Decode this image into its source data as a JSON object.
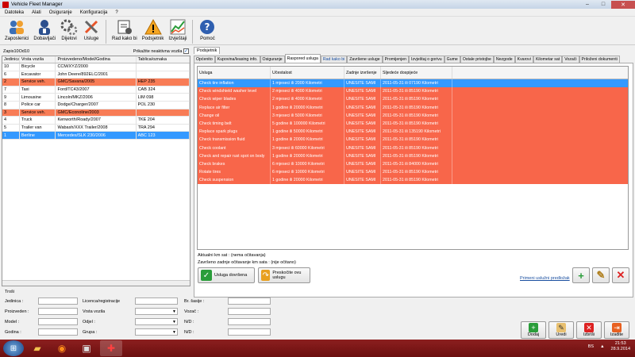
{
  "window": {
    "title": "Vehicle Fleet Manager",
    "min": "–",
    "max": "□",
    "close": "✕"
  },
  "menu": [
    "Datoteka",
    "Alati",
    "Osiguranje",
    "Konfiguracija",
    "?"
  ],
  "toolbar": [
    {
      "label": "Zaposlenici",
      "icon": "people-icon"
    },
    {
      "label": "Dobavljači",
      "icon": "supplier-icon"
    },
    {
      "label": "Dijelovi",
      "icon": "gears-icon"
    },
    {
      "label": "Usluge",
      "icon": "tools-icon"
    },
    {
      "label": "Rad kako bi",
      "icon": "work-order-icon"
    },
    {
      "label": "Podsjetnik",
      "icon": "warning-icon"
    },
    {
      "label": "Izvještaji",
      "icon": "chart-icon"
    },
    {
      "label": "Pomoć",
      "icon": "help-icon"
    }
  ],
  "left": {
    "record_counter": "Zapis10Od10",
    "show_inactive_label": "Prikažite neaktivna vozila",
    "show_inactive_checked": "✓",
    "columns": [
      "Jedinica",
      "Vrsta vozila",
      "Proizvedeno/Model/Godina",
      "Tablica/oznaka"
    ],
    "rows": [
      {
        "jed": "10",
        "vrsta": "Bicycle",
        "model": "CCM/XYZ/2000",
        "tab": "",
        "state": "normal"
      },
      {
        "jed": "6",
        "vrsta": "Excavator",
        "model": "John Deere/892ELC/2001",
        "tab": "",
        "state": "normal"
      },
      {
        "jed": "2",
        "vrsta": "Service veh.",
        "model": "GMC/Savana/2005",
        "tab": "HEP 235",
        "state": "red"
      },
      {
        "jed": "7",
        "vrsta": "Taxi",
        "model": "Ford/TC43/2007",
        "tab": "CAB 324",
        "state": "normal"
      },
      {
        "jed": "9",
        "vrsta": "Limousine",
        "model": "Lincoln/MKZ/2006",
        "tab": "LIM 098",
        "state": "normal"
      },
      {
        "jed": "8",
        "vrsta": "Police car",
        "model": "Dodge/Charger/2007",
        "tab": "POL 230",
        "state": "normal"
      },
      {
        "jed": "3",
        "vrsta": "Service veh.",
        "model": "GMC/Econoline/2003",
        "tab": "",
        "state": "red"
      },
      {
        "jed": "4",
        "vrsta": "Truck",
        "model": "Kenworth/Roady/2007",
        "tab": "TKE 204",
        "state": "normal"
      },
      {
        "jed": "5",
        "vrsta": "Trailer van",
        "model": "Wabash/XXX Trailer/2008",
        "tab": "TRA 294",
        "state": "normal"
      },
      {
        "jed": "1",
        "vrsta": "Berline",
        "model": "Mercedes/SLK 230/2006",
        "tab": "ABC 123",
        "state": "selected"
      }
    ]
  },
  "costs": {
    "title": "Troši",
    "jedinica": "Jedinica :",
    "proizveden": "Proizveden :",
    "model": "Model :",
    "godina": "Godina :",
    "licenca": "Licenca/registracije",
    "vrsta": "Vrsta vozila",
    "odjel": "Odjel :",
    "grupa": "Grupa :",
    "serija": "Br. šasije :",
    "vozac": "Vozač :",
    "nd1": "N/D :",
    "nd2": "N/D :"
  },
  "right": {
    "subtab": "Podsjetnik",
    "tabs": [
      "Općenito",
      "Kupovina/leasing info.",
      "Osiguranje",
      "Raspored usluga",
      "Rad kako bi",
      "Završene usluge",
      "Promijenjen",
      "Izvještaj o gorivu",
      "Gume",
      "Ostale pristojbe",
      "Nezgode",
      "Kvarovi",
      "Kilometar sat",
      "Vozači",
      "Priloženi dokumenti"
    ],
    "active_tab": "Raspored usluga",
    "columns": [
      "Usluga",
      "Učestalost",
      "Zadnje izvršenje",
      "Sljedeće dospijeće"
    ],
    "rows": [
      {
        "usluga": "Check tire inflation",
        "ucestalost": "1 mjeseci ili 2000 Kilometri",
        "zadnje": "UNESITE SAMI",
        "sljedece": "2011-05-31 ili 07190 Kilometri",
        "state": "selected"
      },
      {
        "usluga": "Check windshield washer level",
        "ucestalost": "2 mjeseci ili 4000 Kilometri",
        "zadnje": "UNESITE SAMI",
        "sljedece": "2011-05-31 ili 85190 Kilometri",
        "state": "red"
      },
      {
        "usluga": "Check wiper blades",
        "ucestalost": "2 mjeseci ili 4000 Kilometri",
        "zadnje": "UNESITE SAMI",
        "sljedece": "2011-05-31 ili 85190 Kilometri",
        "state": "red"
      },
      {
        "usluga": "Replace air filter",
        "ucestalost": "1 godine ili 20000 Kilometri",
        "zadnje": "UNESITE SAMI",
        "sljedece": "2011-05-31 ili 85190 Kilometri",
        "state": "red"
      },
      {
        "usluga": "Change oil",
        "ucestalost": "3 mjeseci ili 5000 Kilometri",
        "zadnje": "UNESITE SAMI",
        "sljedece": "2011-05-31 ili 85190 Kilometri",
        "state": "red"
      },
      {
        "usluga": "Check timing belt",
        "ucestalost": "5 godine ili 100000 Kilometri",
        "zadnje": "UNESITE SAMI",
        "sljedece": "2011-05-31 ili 85190 Kilometri",
        "state": "red"
      },
      {
        "usluga": "Replace spark plugs",
        "ucestalost": "1 godine ili 50000 Kilometri",
        "zadnje": "UNESITE SAMI",
        "sljedece": "2011-05-31 ili 135190 Kilometri",
        "state": "red"
      },
      {
        "usluga": "Check transmission fluid",
        "ucestalost": "1 godine ili 20000 Kilometri",
        "zadnje": "UNESITE SAMI",
        "sljedece": "2011-05-31 ili 85190 Kilometri",
        "state": "red"
      },
      {
        "usluga": "Check coolant",
        "ucestalost": "3 mjeseci ili 60000 Kilometri",
        "zadnje": "UNESITE SAMI",
        "sljedece": "2011-05-31 ili 85190 Kilometri",
        "state": "red"
      },
      {
        "usluga": "Check and repair rust spot on body",
        "ucestalost": "1 godine ili 20000 Kilometri",
        "zadnje": "UNESITE SAMI",
        "sljedece": "2011-05-31 ili 85190 Kilometri",
        "state": "red"
      },
      {
        "usluga": "Check brakes",
        "ucestalost": "6 mjeseci ili 10000 Kilometri",
        "zadnje": "UNESITE SAMI",
        "sljedece": "2011-05-31 ili 84000 Kilometri",
        "state": "red"
      },
      {
        "usluga": "Rotate tires",
        "ucestalost": "6 mjeseci ili 10000 Kilometri",
        "zadnje": "UNESITE SAMI",
        "sljedece": "2011-05-31 ili 85190 Kilometri",
        "state": "red"
      },
      {
        "usluga": "Check suspension",
        "ucestalost": "1 godine ili 20000 Kilometri",
        "zadnje": "UNESITE SAMI",
        "sljedece": "2011-05-31 ili 85190 Kilometri",
        "state": "red"
      }
    ],
    "current_km": "Aktualni km sat : (nema očitavanja)",
    "last_km": "Završeno zadnje očitavanje km sata : (nije očitano)",
    "btn_done": "Usluga dovršena",
    "btn_skip": "Preskočite ovu uslugu",
    "link_default": "Primeni uslužni predložak"
  },
  "bottom_buttons": [
    "Dodaj",
    "Uredi",
    "Izbriši",
    "Izađite"
  ],
  "taskbar": {
    "lang": "BS",
    "time": "21:53",
    "date": "28.9.2014"
  },
  "colors": {
    "red_row": "#f8664a",
    "selected_row": "#3399ff"
  }
}
